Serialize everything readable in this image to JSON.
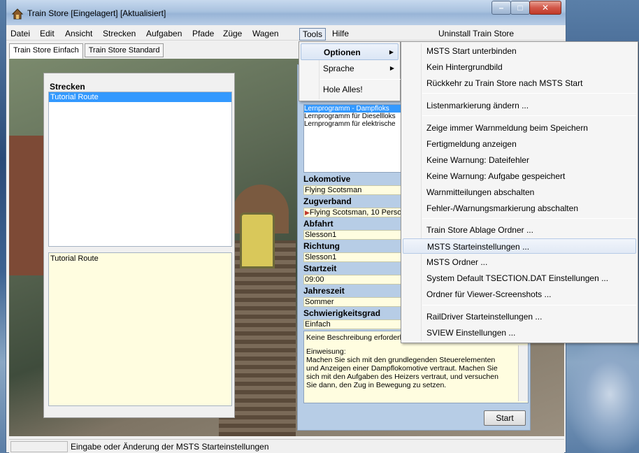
{
  "window": {
    "title": "Train Store [Eingelagert] [Aktualisiert]"
  },
  "menubar": {
    "items": [
      "Datei",
      "Edit",
      "Ansicht",
      "Strecken",
      "Aufgaben",
      "Pfade",
      "Züge",
      "Wagen",
      "Tools",
      "Hilfe"
    ],
    "right_item": "Uninstall Train Store"
  },
  "tabs": [
    "Train Store Einfach",
    "Train Store Standard"
  ],
  "strecken": {
    "title": "Strecken",
    "selected": "Tutorial Route",
    "description": "Tutorial Route"
  },
  "detail": {
    "tab_stub": "E",
    "aufgaben": [
      "Lernprogramm - Dampfloks",
      "Lernprogramm für Diesellloks",
      "Lernprogramm für elektrische"
    ],
    "lokomotive_label": "Lokomotive",
    "lokomotive": "Flying Scotsman",
    "zugverband_label": "Zugverband",
    "zugverband": "Flying Scotsman, 10 Perso",
    "abfahrt_label": "Abfahrt",
    "abfahrt": "Slesson1",
    "richtung_label": "Richtung",
    "richtung": "Slesson1",
    "startzeit_label": "Startzeit",
    "startzeit": "09:00",
    "jahreszeit_label": "Jahreszeit",
    "jahreszeit": "Sommer",
    "schwierigkeit_label": "Schwierigkeitsgrad",
    "schwierigkeit": "Einfach",
    "desc_line1": "Keine Beschreibung erforderli",
    "desc_line2": "Einweisung:",
    "desc_line3": "Machen Sie sich mit den grundlegenden Steuerelementen",
    "desc_line4": "und Anzeigen einer Dampflokomotive vertraut. Machen Sie",
    "desc_line5": "sich mit den Aufgaben des Heizers vertraut, und versuchen",
    "desc_line6": "Sie dann, den Zug in Bewegung zu setzen.",
    "start_label": "Start"
  },
  "tools_menu": [
    "Optionen",
    "Sprache",
    "Hole Alles!"
  ],
  "optionen_menu": [
    "MSTS Start unterbinden",
    "Kein Hintergrundbild",
    "Rückkehr zu Train Store nach MSTS Start",
    "Listenmarkierung ändern ...",
    "Zeige immer Warnmeldung beim Speichern",
    "Fertigmeldung anzeigen",
    "Keine Warnung: Dateifehler",
    "Keine Warnung: Aufgabe gespeichert",
    "Warnmitteilungen abschalten",
    "Fehler-/Warnungsmarkierung abschalten",
    "Train Store Ablage Ordner ...",
    "MSTS Starteinstellungen ...",
    "MSTS Ordner ...",
    "System Default TSECTION.DAT Einstellungen ...",
    "Ordner für Viewer-Screenshots ...",
    "RailDriver Starteinstellungen ...",
    "SVIEW Einstellungen ..."
  ],
  "status": {
    "text": "Eingabe oder Änderung der MSTS Starteinstellungen"
  }
}
